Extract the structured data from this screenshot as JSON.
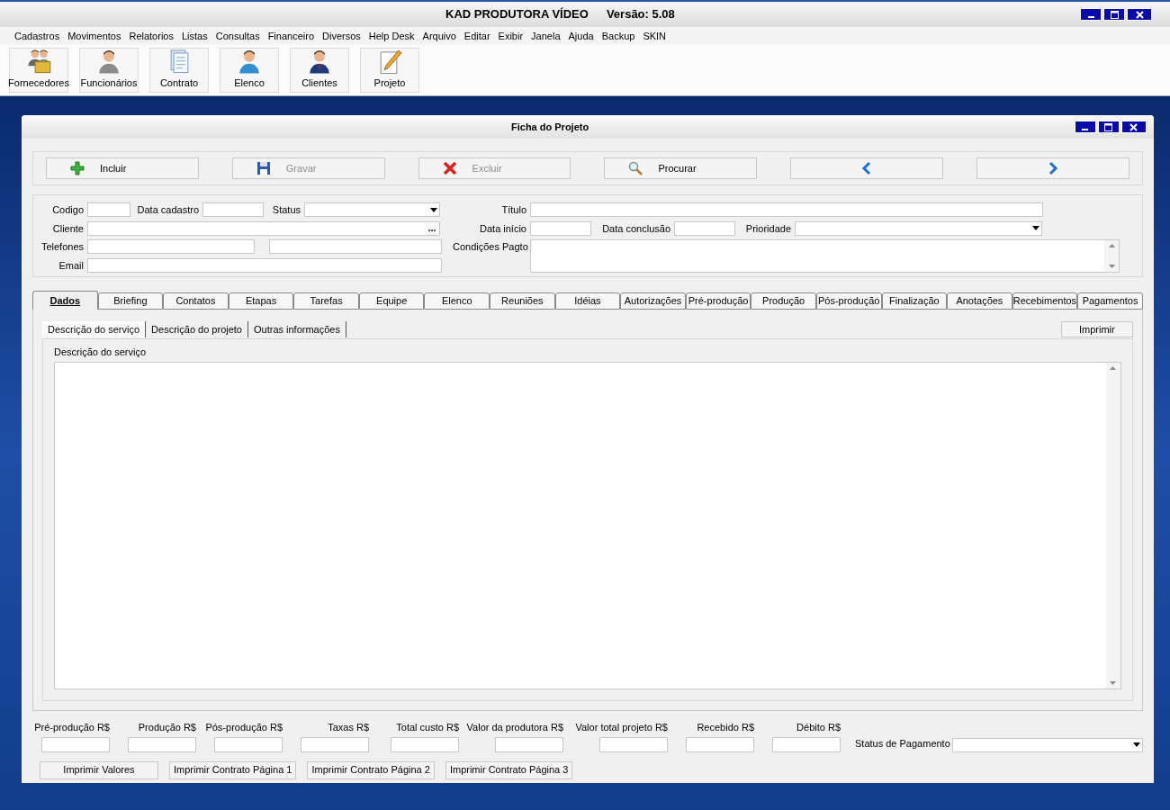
{
  "window": {
    "title": "KAD PRODUTORA VÍDEO",
    "version": "Versão: 5.08"
  },
  "menu": [
    "Cadastros",
    "Movimentos",
    "Relatorios",
    "Listas",
    "Consultas",
    "Financeiro",
    "Diversos",
    "Help Desk",
    "Arquivo",
    "Editar",
    "Exibir",
    "Janela",
    "Ajuda",
    "Backup",
    "SKIN"
  ],
  "toolbar": [
    {
      "label": "Fornecedores",
      "kind": "group"
    },
    {
      "label": "Funcionários",
      "kind": "grayperson"
    },
    {
      "label": "Contrato",
      "kind": "document"
    },
    {
      "label": "Elenco",
      "kind": "blueperson"
    },
    {
      "label": "Clientes",
      "kind": "suitperson"
    },
    {
      "label": "Projeto",
      "kind": "pencil"
    }
  ],
  "form_window": {
    "title": "Ficha do Projeto"
  },
  "actions": [
    {
      "label": "Incluir",
      "kind": "add",
      "disabled": false
    },
    {
      "label": "Gravar",
      "kind": "save",
      "disabled": true
    },
    {
      "label": "Excluir",
      "kind": "delete",
      "disabled": true
    },
    {
      "label": "Procurar",
      "kind": "search",
      "disabled": false
    },
    {
      "kind": "prev",
      "disabled": false
    },
    {
      "kind": "next",
      "disabled": false
    }
  ],
  "form_labels": [
    "Codigo",
    "Data cadastro",
    "Status",
    "Cliente",
    "Telefones",
    "Email",
    "Título",
    "Data início",
    "Data conclusão",
    "Prioridade",
    "Condições Pagto"
  ],
  "client_button": "...",
  "tabs": [
    {
      "label": "Dados",
      "selected": true
    },
    {
      "label": "Briefing",
      "selected": false
    },
    {
      "label": "Contatos",
      "selected": false
    },
    {
      "label": "Etapas",
      "selected": false
    },
    {
      "label": "Tarefas",
      "selected": false
    },
    {
      "label": "Equipe",
      "selected": false
    },
    {
      "label": "Elenco",
      "selected": false
    },
    {
      "label": "Reuniões",
      "selected": false
    },
    {
      "label": "Idéias",
      "selected": false
    },
    {
      "label": "Autorizações",
      "selected": false
    },
    {
      "label": "Pré-produção",
      "selected": false
    },
    {
      "label": "Produção",
      "selected": false
    },
    {
      "label": "Pós-produção",
      "selected": false
    },
    {
      "label": "Finalização",
      "selected": false
    },
    {
      "label": "Anotações",
      "selected": false
    },
    {
      "label": "Recebimentos",
      "selected": false
    },
    {
      "label": "Pagamentos",
      "selected": false
    }
  ],
  "subtabs": [
    {
      "label": "Descrição do serviço",
      "selected": true
    },
    {
      "label": "Descrição do projeto",
      "selected": false
    },
    {
      "label": "Outras informações",
      "selected": false
    }
  ],
  "print_button": "Imprimir",
  "description_label": "Descrição do serviço",
  "totals": [
    "Pré-produção R$",
    "Produção R$",
    "Pós-produção R$",
    "Taxas R$",
    "Total custo R$",
    "Valor da produtora R$",
    "Valor total projeto R$",
    "Recebido R$",
    "Débito R$"
  ],
  "payment_status_label": "Status de Pagamento",
  "bottom_buttons": [
    "Imprimir Valores",
    "Imprimir Contrato Página 1",
    "Imprimir Contrato Página 2",
    "Imprimir Contrato Página 3"
  ]
}
